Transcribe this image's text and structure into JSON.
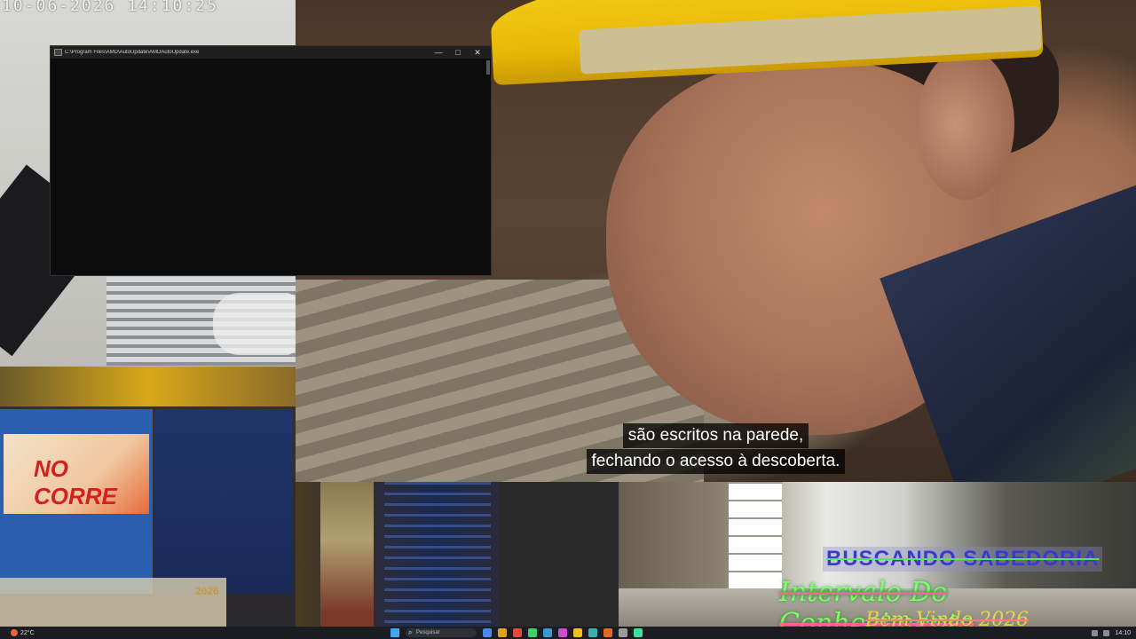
{
  "camera_top_left": {
    "timestamp": "10-06-2026 14:10:25"
  },
  "terminal": {
    "title": "C:\\Program Files\\AMD\\AutoUpdate\\AMDAutoUpdate.exe",
    "minimize": "—",
    "maximize": "□",
    "close": "✕"
  },
  "main_video": {
    "subtitle_line_1": "são escritos na parede,",
    "subtitle_line_2": "fechando o acesso à descoberta."
  },
  "monitor": {
    "banner_title": "NO CORRE",
    "year": "2026"
  },
  "overlay": {
    "line_1": "BUSCANDO  SABEDORIA",
    "line_2": "Intervalo Do Conhecimento",
    "line_3": "Bem Vindo 2026"
  },
  "taskbar": {
    "weather": "22°C",
    "search_placeholder": "Pesquisar",
    "time": "14:10",
    "app_colors": [
      "#4a8af0",
      "#e0a020",
      "#e04a3a",
      "#3ad06a",
      "#3a9ad0",
      "#d04ad0",
      "#f0c020",
      "#3ab0b0",
      "#e06a20",
      "#9a9a9a",
      "#3ae0a0"
    ]
  },
  "colors": {
    "helmet": "#f5cf1a",
    "overlay_blue": "#3a3ad0",
    "overlay_green": "#7dff6a",
    "overlay_yellow": "#e8d44a"
  }
}
